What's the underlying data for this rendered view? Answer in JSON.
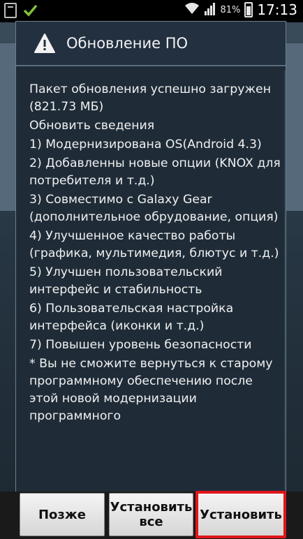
{
  "status_bar": {
    "battery_percent": "81%",
    "time": "17:13",
    "battery_level": 0.81,
    "icons": [
      "sd-card-icon",
      "download-complete-icon",
      "wifi-icon",
      "signal-icon",
      "battery-icon"
    ]
  },
  "dialog": {
    "title": "Обновление ПО",
    "icon": "warning-icon",
    "body": [
      "Пакет обновления успешно загружен (821.73 МБ)",
      "Обновить сведения",
      "1) Модернизирована OS(Android 4.3)",
      "2) Добавленны новые опции (KNOX для потребителя и т.д.)",
      "3) Совместимо с Galaxy Gear (дополнительное обрудование, опция)",
      "4) Улучшенное качество работы (графика, мультимедия, блютус и т.д.)",
      "5) Улучшен пользовательский интерфейс и стабильность",
      "6) Пользовательская настройка интерфейса (иконки и т.д.)",
      "7) Повышен уровень безопасности",
      "* Вы не сможите вернуться к старому программному обеспечению после этой новой модернизации программного"
    ]
  },
  "buttons": {
    "later": "Позже",
    "install_all": "Установить все",
    "install": "Установить"
  },
  "colors": {
    "highlight": "#e0161b",
    "dialog_bg": "#1f2c38"
  }
}
